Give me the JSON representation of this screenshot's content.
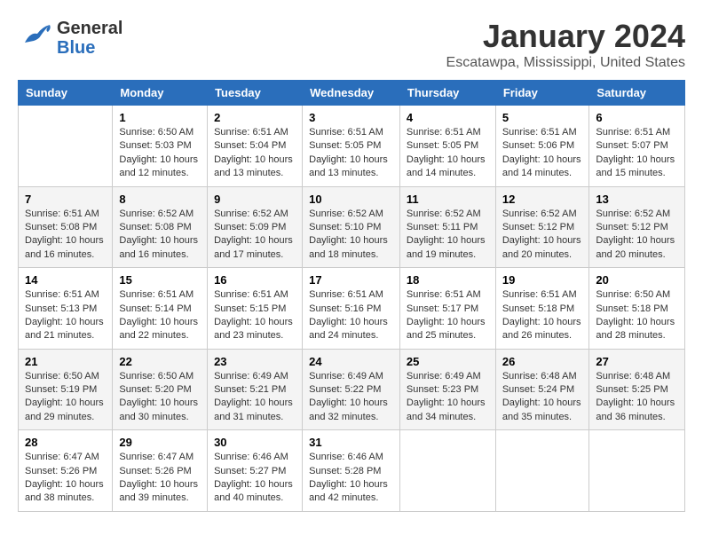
{
  "header": {
    "logo_line1": "General",
    "logo_line2": "Blue",
    "month": "January 2024",
    "location": "Escatawpa, Mississippi, United States"
  },
  "weekdays": [
    "Sunday",
    "Monday",
    "Tuesday",
    "Wednesday",
    "Thursday",
    "Friday",
    "Saturday"
  ],
  "weeks": [
    [
      {
        "day": "",
        "sunrise": "",
        "sunset": "",
        "daylight": ""
      },
      {
        "day": "1",
        "sunrise": "Sunrise: 6:50 AM",
        "sunset": "Sunset: 5:03 PM",
        "daylight": "Daylight: 10 hours and 12 minutes."
      },
      {
        "day": "2",
        "sunrise": "Sunrise: 6:51 AM",
        "sunset": "Sunset: 5:04 PM",
        "daylight": "Daylight: 10 hours and 13 minutes."
      },
      {
        "day": "3",
        "sunrise": "Sunrise: 6:51 AM",
        "sunset": "Sunset: 5:05 PM",
        "daylight": "Daylight: 10 hours and 13 minutes."
      },
      {
        "day": "4",
        "sunrise": "Sunrise: 6:51 AM",
        "sunset": "Sunset: 5:05 PM",
        "daylight": "Daylight: 10 hours and 14 minutes."
      },
      {
        "day": "5",
        "sunrise": "Sunrise: 6:51 AM",
        "sunset": "Sunset: 5:06 PM",
        "daylight": "Daylight: 10 hours and 14 minutes."
      },
      {
        "day": "6",
        "sunrise": "Sunrise: 6:51 AM",
        "sunset": "Sunset: 5:07 PM",
        "daylight": "Daylight: 10 hours and 15 minutes."
      }
    ],
    [
      {
        "day": "7",
        "sunrise": "Sunrise: 6:51 AM",
        "sunset": "Sunset: 5:08 PM",
        "daylight": "Daylight: 10 hours and 16 minutes."
      },
      {
        "day": "8",
        "sunrise": "Sunrise: 6:52 AM",
        "sunset": "Sunset: 5:08 PM",
        "daylight": "Daylight: 10 hours and 16 minutes."
      },
      {
        "day": "9",
        "sunrise": "Sunrise: 6:52 AM",
        "sunset": "Sunset: 5:09 PM",
        "daylight": "Daylight: 10 hours and 17 minutes."
      },
      {
        "day": "10",
        "sunrise": "Sunrise: 6:52 AM",
        "sunset": "Sunset: 5:10 PM",
        "daylight": "Daylight: 10 hours and 18 minutes."
      },
      {
        "day": "11",
        "sunrise": "Sunrise: 6:52 AM",
        "sunset": "Sunset: 5:11 PM",
        "daylight": "Daylight: 10 hours and 19 minutes."
      },
      {
        "day": "12",
        "sunrise": "Sunrise: 6:52 AM",
        "sunset": "Sunset: 5:12 PM",
        "daylight": "Daylight: 10 hours and 20 minutes."
      },
      {
        "day": "13",
        "sunrise": "Sunrise: 6:52 AM",
        "sunset": "Sunset: 5:12 PM",
        "daylight": "Daylight: 10 hours and 20 minutes."
      }
    ],
    [
      {
        "day": "14",
        "sunrise": "Sunrise: 6:51 AM",
        "sunset": "Sunset: 5:13 PM",
        "daylight": "Daylight: 10 hours and 21 minutes."
      },
      {
        "day": "15",
        "sunrise": "Sunrise: 6:51 AM",
        "sunset": "Sunset: 5:14 PM",
        "daylight": "Daylight: 10 hours and 22 minutes."
      },
      {
        "day": "16",
        "sunrise": "Sunrise: 6:51 AM",
        "sunset": "Sunset: 5:15 PM",
        "daylight": "Daylight: 10 hours and 23 minutes."
      },
      {
        "day": "17",
        "sunrise": "Sunrise: 6:51 AM",
        "sunset": "Sunset: 5:16 PM",
        "daylight": "Daylight: 10 hours and 24 minutes."
      },
      {
        "day": "18",
        "sunrise": "Sunrise: 6:51 AM",
        "sunset": "Sunset: 5:17 PM",
        "daylight": "Daylight: 10 hours and 25 minutes."
      },
      {
        "day": "19",
        "sunrise": "Sunrise: 6:51 AM",
        "sunset": "Sunset: 5:18 PM",
        "daylight": "Daylight: 10 hours and 26 minutes."
      },
      {
        "day": "20",
        "sunrise": "Sunrise: 6:50 AM",
        "sunset": "Sunset: 5:18 PM",
        "daylight": "Daylight: 10 hours and 28 minutes."
      }
    ],
    [
      {
        "day": "21",
        "sunrise": "Sunrise: 6:50 AM",
        "sunset": "Sunset: 5:19 PM",
        "daylight": "Daylight: 10 hours and 29 minutes."
      },
      {
        "day": "22",
        "sunrise": "Sunrise: 6:50 AM",
        "sunset": "Sunset: 5:20 PM",
        "daylight": "Daylight: 10 hours and 30 minutes."
      },
      {
        "day": "23",
        "sunrise": "Sunrise: 6:49 AM",
        "sunset": "Sunset: 5:21 PM",
        "daylight": "Daylight: 10 hours and 31 minutes."
      },
      {
        "day": "24",
        "sunrise": "Sunrise: 6:49 AM",
        "sunset": "Sunset: 5:22 PM",
        "daylight": "Daylight: 10 hours and 32 minutes."
      },
      {
        "day": "25",
        "sunrise": "Sunrise: 6:49 AM",
        "sunset": "Sunset: 5:23 PM",
        "daylight": "Daylight: 10 hours and 34 minutes."
      },
      {
        "day": "26",
        "sunrise": "Sunrise: 6:48 AM",
        "sunset": "Sunset: 5:24 PM",
        "daylight": "Daylight: 10 hours and 35 minutes."
      },
      {
        "day": "27",
        "sunrise": "Sunrise: 6:48 AM",
        "sunset": "Sunset: 5:25 PM",
        "daylight": "Daylight: 10 hours and 36 minutes."
      }
    ],
    [
      {
        "day": "28",
        "sunrise": "Sunrise: 6:47 AM",
        "sunset": "Sunset: 5:26 PM",
        "daylight": "Daylight: 10 hours and 38 minutes."
      },
      {
        "day": "29",
        "sunrise": "Sunrise: 6:47 AM",
        "sunset": "Sunset: 5:26 PM",
        "daylight": "Daylight: 10 hours and 39 minutes."
      },
      {
        "day": "30",
        "sunrise": "Sunrise: 6:46 AM",
        "sunset": "Sunset: 5:27 PM",
        "daylight": "Daylight: 10 hours and 40 minutes."
      },
      {
        "day": "31",
        "sunrise": "Sunrise: 6:46 AM",
        "sunset": "Sunset: 5:28 PM",
        "daylight": "Daylight: 10 hours and 42 minutes."
      },
      {
        "day": "",
        "sunrise": "",
        "sunset": "",
        "daylight": ""
      },
      {
        "day": "",
        "sunrise": "",
        "sunset": "",
        "daylight": ""
      },
      {
        "day": "",
        "sunrise": "",
        "sunset": "",
        "daylight": ""
      }
    ]
  ]
}
